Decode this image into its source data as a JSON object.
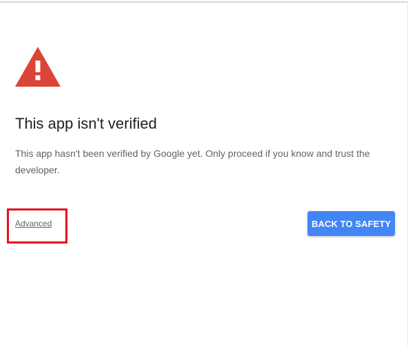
{
  "warning": {
    "icon": "warning-triangle-icon",
    "color": "#db4437"
  },
  "title": "This app isn't verified",
  "body": "This app hasn't been verified by Google yet. Only proceed if you know and trust the developer.",
  "advanced_link": "Advanced",
  "back_button": "BACK TO SAFETY",
  "colors": {
    "primary_button": "#4285f4",
    "highlight": "#e3101c"
  }
}
